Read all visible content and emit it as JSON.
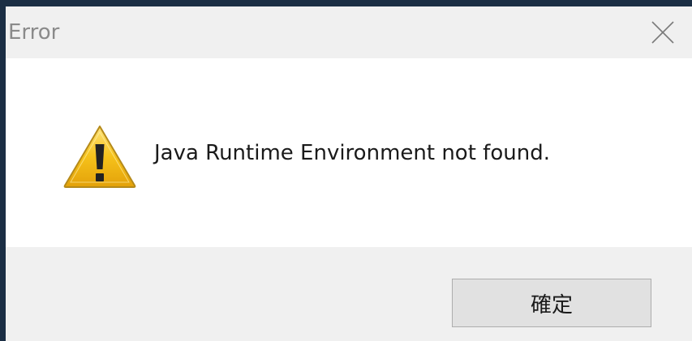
{
  "dialog": {
    "title": "Error",
    "message": "Java Runtime Environment not found.",
    "ok_label": "確定",
    "icon": "warning-icon",
    "close_icon": "close-icon"
  },
  "colors": {
    "desktop": "#1b2e44",
    "titlebar": "#f0f0f0",
    "content": "#ffffff",
    "footer": "#f0f0f0",
    "warning_fill": "#f6c21a",
    "button_bg": "#e1e1e1"
  }
}
